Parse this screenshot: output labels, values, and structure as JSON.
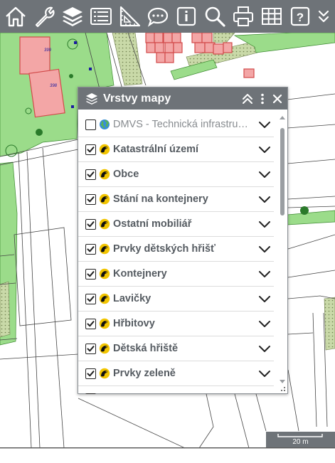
{
  "toolbar": {
    "buttons": [
      {
        "icon": "home-icon"
      },
      {
        "icon": "wrench-icon"
      },
      {
        "icon": "layers-icon"
      },
      {
        "icon": "list-icon"
      },
      {
        "icon": "ruler-triangle-icon"
      },
      {
        "icon": "speech-bubble-icon"
      },
      {
        "icon": "info-icon"
      },
      {
        "icon": "search-icon"
      },
      {
        "icon": "print-icon"
      },
      {
        "icon": "grid-icon"
      },
      {
        "icon": "help-icon"
      },
      {
        "icon": "chevron-double-down-icon"
      }
    ],
    "help_label": "?"
  },
  "map": {
    "parcel_labels": [
      "399",
      "398"
    ]
  },
  "layer_panel": {
    "title": "Vrstvy mapy",
    "layers": [
      {
        "label": "DMVS - Technická infrastrukt...",
        "checked": false,
        "icon": "globe-icon",
        "dim": true
      },
      {
        "label": "Katastrální území",
        "checked": true,
        "icon": "layer-source-icon"
      },
      {
        "label": "Obce",
        "checked": true,
        "icon": "layer-source-icon"
      },
      {
        "label": "Stání na kontejnery",
        "checked": true,
        "icon": "layer-source-icon"
      },
      {
        "label": "Ostatní mobiliář",
        "checked": true,
        "icon": "layer-source-icon"
      },
      {
        "label": "Prvky dětských hřišť",
        "checked": true,
        "icon": "layer-source-icon"
      },
      {
        "label": "Kontejnery",
        "checked": true,
        "icon": "layer-source-icon"
      },
      {
        "label": "Lavičky",
        "checked": true,
        "icon": "layer-source-icon"
      },
      {
        "label": "Hřbitovy",
        "checked": true,
        "icon": "layer-source-icon"
      },
      {
        "label": "Dětská hřiště",
        "checked": true,
        "icon": "layer-source-icon"
      },
      {
        "label": "Prvky zeleně",
        "checked": true,
        "icon": "layer-source-icon"
      }
    ]
  },
  "scale": {
    "label": "20 m"
  },
  "colors": {
    "toolbar_bg": "#6e7378",
    "grass": "#9bdc8a",
    "building": "#f3a6a6",
    "building_stroke": "#d24a4a"
  }
}
